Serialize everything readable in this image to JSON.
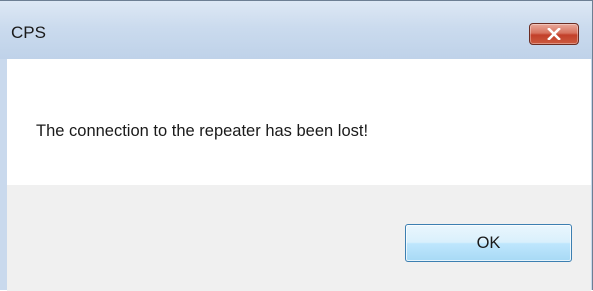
{
  "window": {
    "title": "CPS",
    "close_icon": "close-icon"
  },
  "dialog": {
    "message": "The connection to the repeater has been lost!",
    "ok_label": "OK"
  },
  "colors": {
    "titlebar": "#c9d9ed",
    "close_button": "#c9452e",
    "ok_button_border": "#3c7fb1",
    "content_background": "#ffffff",
    "button_area_background": "#f0f0f0"
  }
}
